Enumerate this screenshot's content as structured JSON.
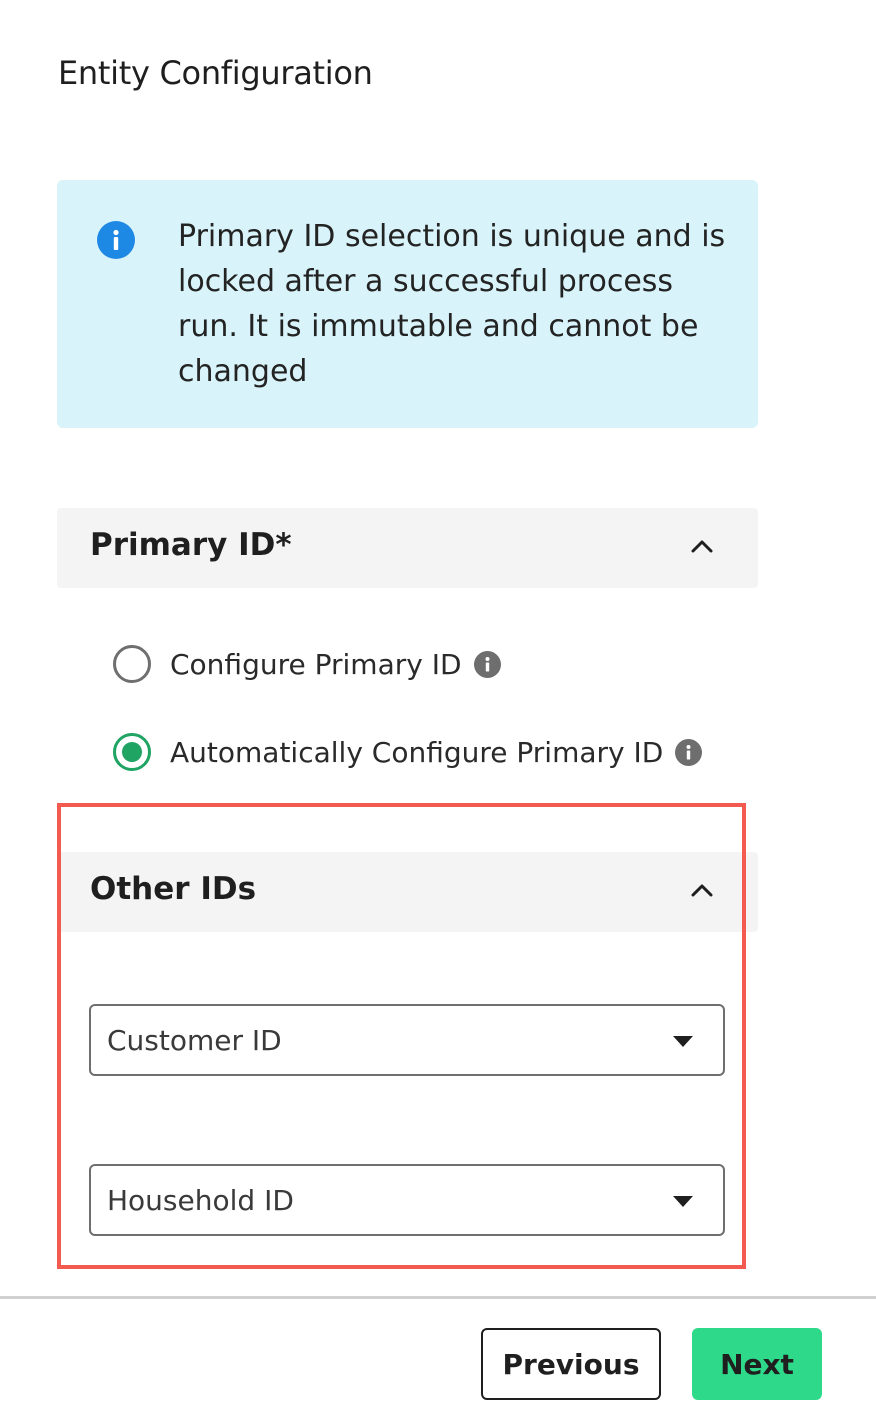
{
  "page": {
    "title": "Entity Configuration"
  },
  "info_banner": {
    "text": "Primary ID selection is unique and is locked after a successful process run. It is immutable and cannot be changed",
    "icon": "info-icon"
  },
  "primary_id": {
    "header": "Primary ID*",
    "expanded": true,
    "options": [
      {
        "label": "Configure Primary ID",
        "selected": false
      },
      {
        "label": "Automatically Configure Primary ID",
        "selected": true
      }
    ]
  },
  "other_ids": {
    "header": "Other IDs",
    "expanded": true,
    "selects": [
      {
        "value": "Customer ID"
      },
      {
        "value": "Household ID"
      }
    ]
  },
  "footer": {
    "previous_label": "Previous",
    "next_label": "Next"
  },
  "colors": {
    "accent_green": "#2fd98a",
    "radio_green": "#1fa463",
    "info_blue": "#1e88e5",
    "banner_bg": "#d8f4fa",
    "highlight_red": "#f45b50"
  }
}
